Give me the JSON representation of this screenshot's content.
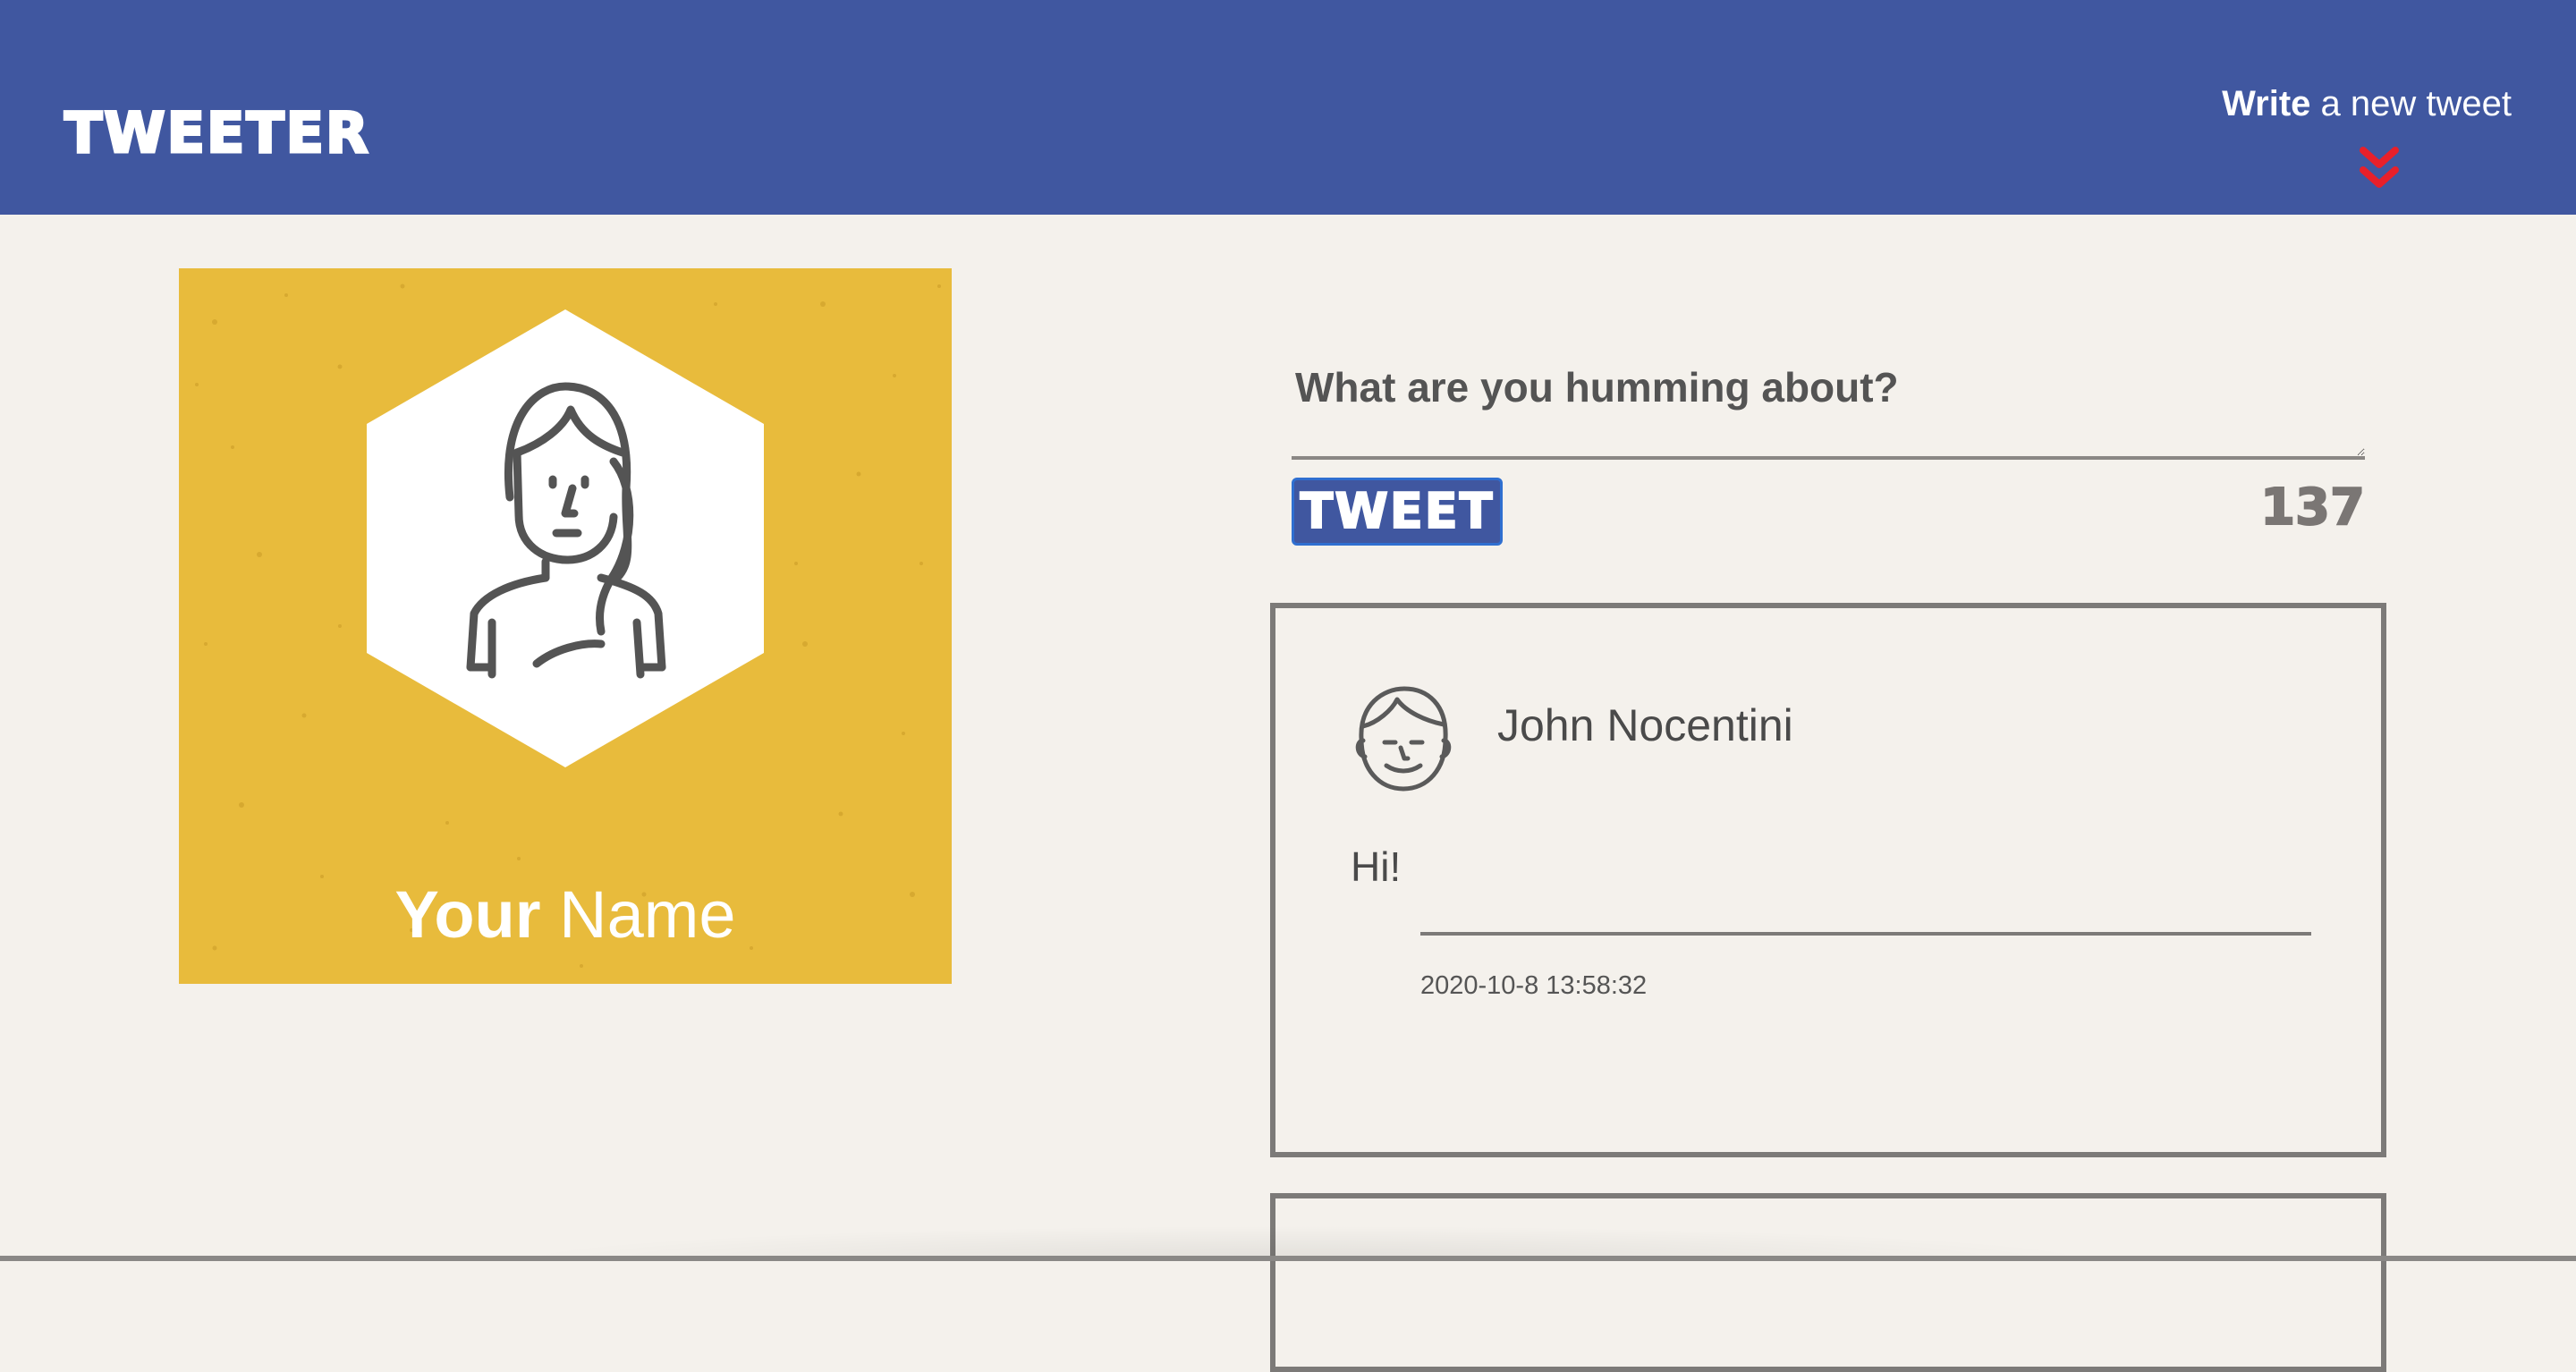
{
  "nav": {
    "brand": "TWEETER",
    "compose_bold": "Write",
    "compose_rest": " a new tweet",
    "compose_icon": "double-chevron-down-icon",
    "background_color": "#4057a0",
    "chevron_color": "#e8202a"
  },
  "profile": {
    "avatar_icon": "user-avatar-icon",
    "name_bold": "Your",
    "name_rest": " Name",
    "background_color": "#e8bb3c"
  },
  "composer": {
    "placeholder": "What are you humming about?",
    "value": "",
    "submit_label": "TWEET",
    "char_counter": "137"
  },
  "tweets": [
    {
      "avatar_icon": "user-avatar-icon",
      "author": "John Nocentini",
      "body": "Hi!",
      "timestamp": "2020-10-8 13:58:32"
    }
  ]
}
